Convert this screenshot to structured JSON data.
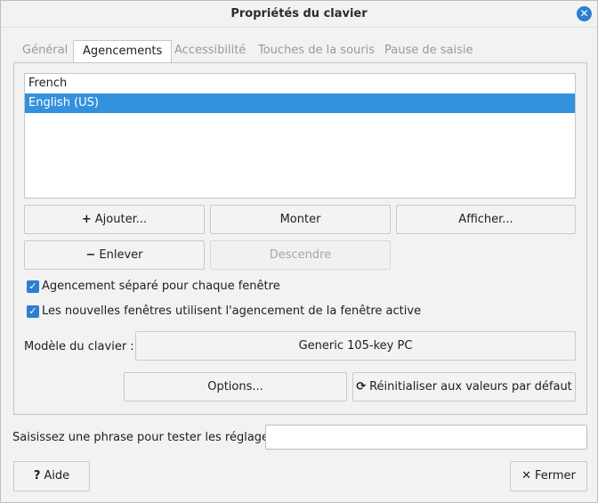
{
  "window": {
    "title": "Propriétés du clavier",
    "close_glyph": "✕"
  },
  "tabs": [
    {
      "label": "Général",
      "active": false
    },
    {
      "label": "Agencements",
      "active": true
    },
    {
      "label": "Accessibilité",
      "active": false
    },
    {
      "label": "Touches de la souris",
      "active": false
    },
    {
      "label": "Pause de saisie",
      "active": false
    }
  ],
  "layouts": {
    "items": [
      {
        "label": "French",
        "selected": false
      },
      {
        "label": "English (US)",
        "selected": true
      }
    ],
    "selection_color": "#3491dd"
  },
  "buttons": {
    "add": {
      "label": "Ajouter...",
      "icon": "plus-icon",
      "glyph": "+"
    },
    "move_up": {
      "label": "Monter"
    },
    "show": {
      "label": "Afficher..."
    },
    "remove": {
      "label": "Enlever",
      "icon": "minus-icon",
      "glyph": "−"
    },
    "move_down": {
      "label": "Descendre",
      "disabled": true
    }
  },
  "checkboxes": {
    "separate_per_window": {
      "label": "Agencement séparé pour chaque fenêtre",
      "checked": true,
      "glyph": "✓"
    },
    "new_windows_active": {
      "label": "Les nouvelles fenêtres utilisent l'agencement de la fenêtre active",
      "checked": true,
      "glyph": "✓"
    }
  },
  "keyboard_model": {
    "label": "Modèle du clavier :",
    "value": "Generic 105-key PC"
  },
  "options_button": {
    "label": "Options..."
  },
  "reset_button": {
    "label": "Réinitialiser aux valeurs par défaut",
    "icon": "refresh-icon",
    "glyph": "⟳"
  },
  "test": {
    "label": "Saisissez une phrase pour tester les réglages :",
    "value": ""
  },
  "footer": {
    "help": {
      "label": "Aide",
      "icon": "question-icon",
      "glyph": "?"
    },
    "close": {
      "label": "Fermer",
      "icon": "close-icon",
      "glyph": "✕"
    }
  },
  "colors": {
    "accent": "#2e7ed1"
  }
}
